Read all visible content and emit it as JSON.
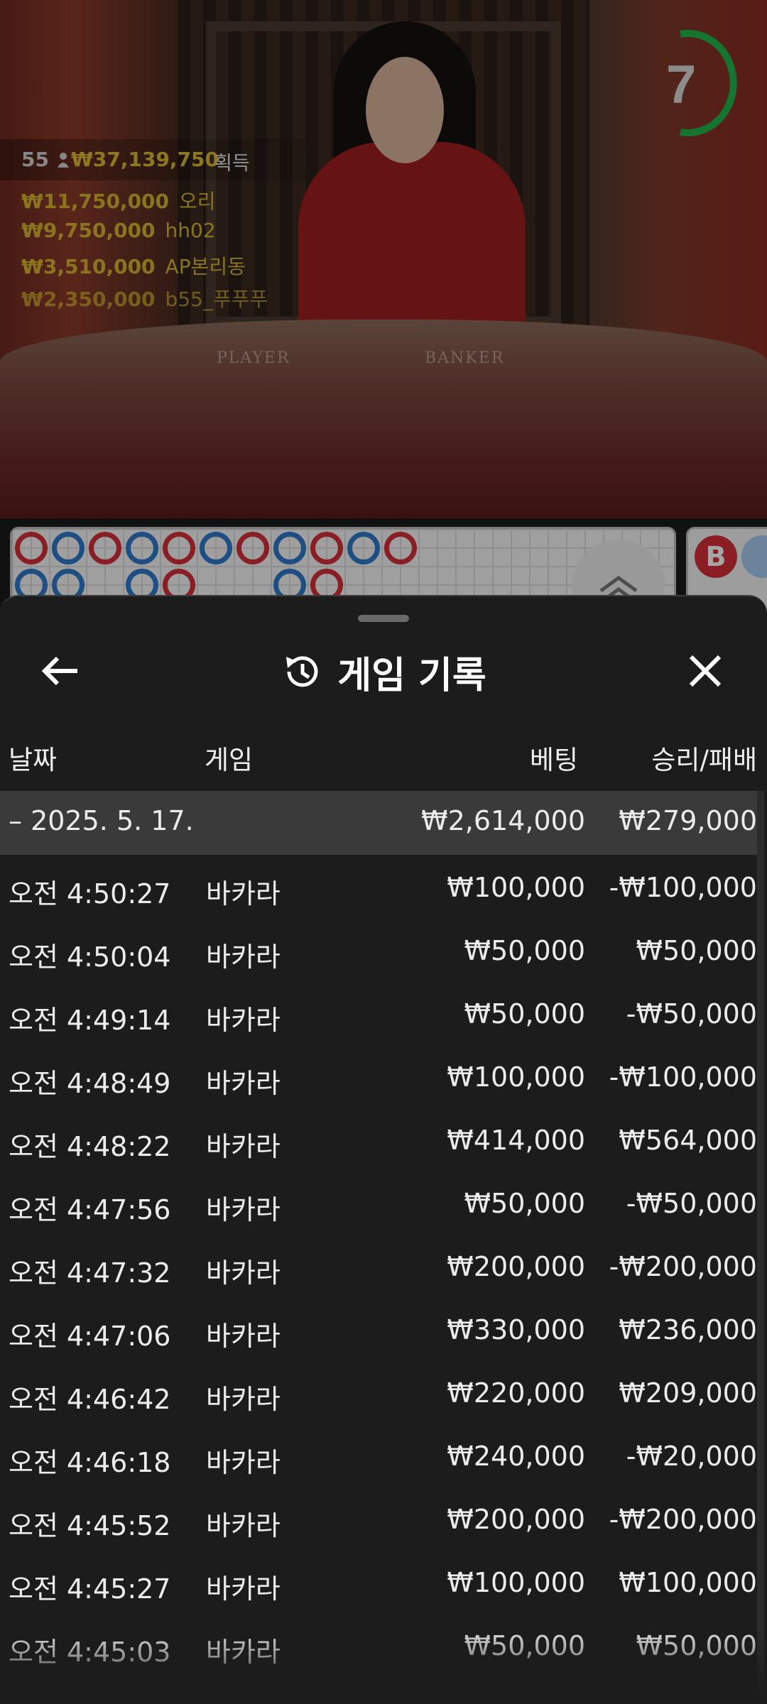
{
  "stream": {
    "countdown": "7",
    "table_left_label": "PLAYER",
    "table_right_label": "BANKER",
    "winners_total": {
      "count": "55",
      "amount": "₩37,139,750",
      "label": "획득"
    },
    "winners": [
      {
        "amount": "₩11,750,000",
        "name": "오리"
      },
      {
        "amount": "₩9,750,000",
        "name": "hh02"
      },
      {
        "amount": "₩3,510,000",
        "name": "AP본리동"
      },
      {
        "amount": "₩2,350,000",
        "name": "b55_푸푸푸"
      }
    ],
    "bead_road": [
      [
        "B",
        "P"
      ],
      [
        "P",
        "P"
      ],
      [
        "B"
      ],
      [
        "P",
        "P"
      ],
      [
        "B",
        "B"
      ],
      [
        "P"
      ],
      [
        "B"
      ],
      [
        "P",
        "P"
      ],
      [
        "B",
        "B"
      ],
      [
        "P"
      ],
      [
        "B"
      ]
    ],
    "banker_badge": "B",
    "colors": {
      "banker": "#d32f3a",
      "player": "#2e78c8",
      "gold": "#d4b42e",
      "timer": "#1fb34a"
    }
  },
  "history": {
    "title": "게임 기록",
    "icons": {
      "back": "arrow-left-icon",
      "history": "history-clock-icon",
      "close": "close-icon"
    },
    "columns": {
      "date": "날짜",
      "game": "게임",
      "bet": "베팅",
      "result": "승리/패배"
    },
    "date_group": {
      "date": "– 2025. 5. 17.",
      "bet": "₩2,614,000",
      "result": "₩279,000"
    },
    "rows": [
      {
        "time": "오전 4:50:27",
        "game": "바카라",
        "bet": "₩100,000",
        "result": "-₩100,000"
      },
      {
        "time": "오전 4:50:04",
        "game": "바카라",
        "bet": "₩50,000",
        "result": "₩50,000"
      },
      {
        "time": "오전 4:49:14",
        "game": "바카라",
        "bet": "₩50,000",
        "result": "-₩50,000"
      },
      {
        "time": "오전 4:48:49",
        "game": "바카라",
        "bet": "₩100,000",
        "result": "-₩100,000"
      },
      {
        "time": "오전 4:48:22",
        "game": "바카라",
        "bet": "₩414,000",
        "result": "₩564,000"
      },
      {
        "time": "오전 4:47:56",
        "game": "바카라",
        "bet": "₩50,000",
        "result": "-₩50,000"
      },
      {
        "time": "오전 4:47:32",
        "game": "바카라",
        "bet": "₩200,000",
        "result": "-₩200,000"
      },
      {
        "time": "오전 4:47:06",
        "game": "바카라",
        "bet": "₩330,000",
        "result": "₩236,000"
      },
      {
        "time": "오전 4:46:42",
        "game": "바카라",
        "bet": "₩220,000",
        "result": "₩209,000"
      },
      {
        "time": "오전 4:46:18",
        "game": "바카라",
        "bet": "₩240,000",
        "result": "-₩20,000"
      },
      {
        "time": "오전 4:45:52",
        "game": "바카라",
        "bet": "₩200,000",
        "result": "-₩200,000"
      },
      {
        "time": "오전 4:45:27",
        "game": "바카라",
        "bet": "₩100,000",
        "result": "₩100,000"
      },
      {
        "time": "오전 4:45:03",
        "game": "바카라",
        "bet": "₩50,000",
        "result": "₩50,000"
      }
    ]
  }
}
